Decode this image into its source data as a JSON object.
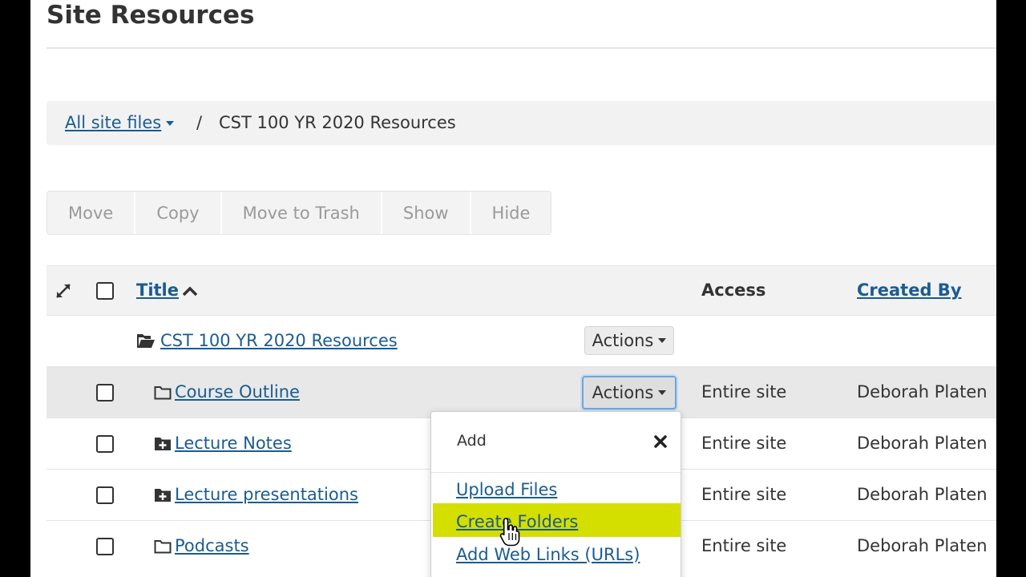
{
  "page": {
    "title": "Site Resources"
  },
  "breadcrumb": {
    "root_label": "All site files",
    "separator": "/",
    "current": "CST 100 YR 2020 Resources"
  },
  "toolbar": {
    "buttons": [
      "Move",
      "Copy",
      "Move to Trash",
      "Show",
      "Hide"
    ]
  },
  "table": {
    "headers": {
      "title": "Title",
      "access": "Access",
      "created_by": "Created By"
    },
    "parent": {
      "name": "CST 100 YR 2020 Resources",
      "actions_label": "Actions"
    },
    "rows": [
      {
        "name": "Course Outline",
        "actions_label": "Actions",
        "access": "Entire site",
        "created_by": "Deborah Platen",
        "icon": "folder-open-icon"
      },
      {
        "name": "Lecture Notes",
        "access": "Entire site",
        "created_by": "Deborah Platen",
        "icon": "folder-plus-icon"
      },
      {
        "name": "Lecture presentations",
        "access": "Entire site",
        "created_by": "Deborah Platen",
        "icon": "folder-plus-icon"
      },
      {
        "name": "Podcasts",
        "access": "Entire site",
        "created_by": "Deborah Platen",
        "icon": "folder-open-icon"
      }
    ]
  },
  "dropdown": {
    "header": "Add",
    "items": [
      "Upload Files",
      "Create Folders",
      "Add Web Links (URLs)"
    ],
    "highlighted_item": "Create Folders",
    "highlight_color": "#d4df00"
  },
  "colors": {
    "link": "#1a5c91",
    "background": "#ffffff"
  }
}
